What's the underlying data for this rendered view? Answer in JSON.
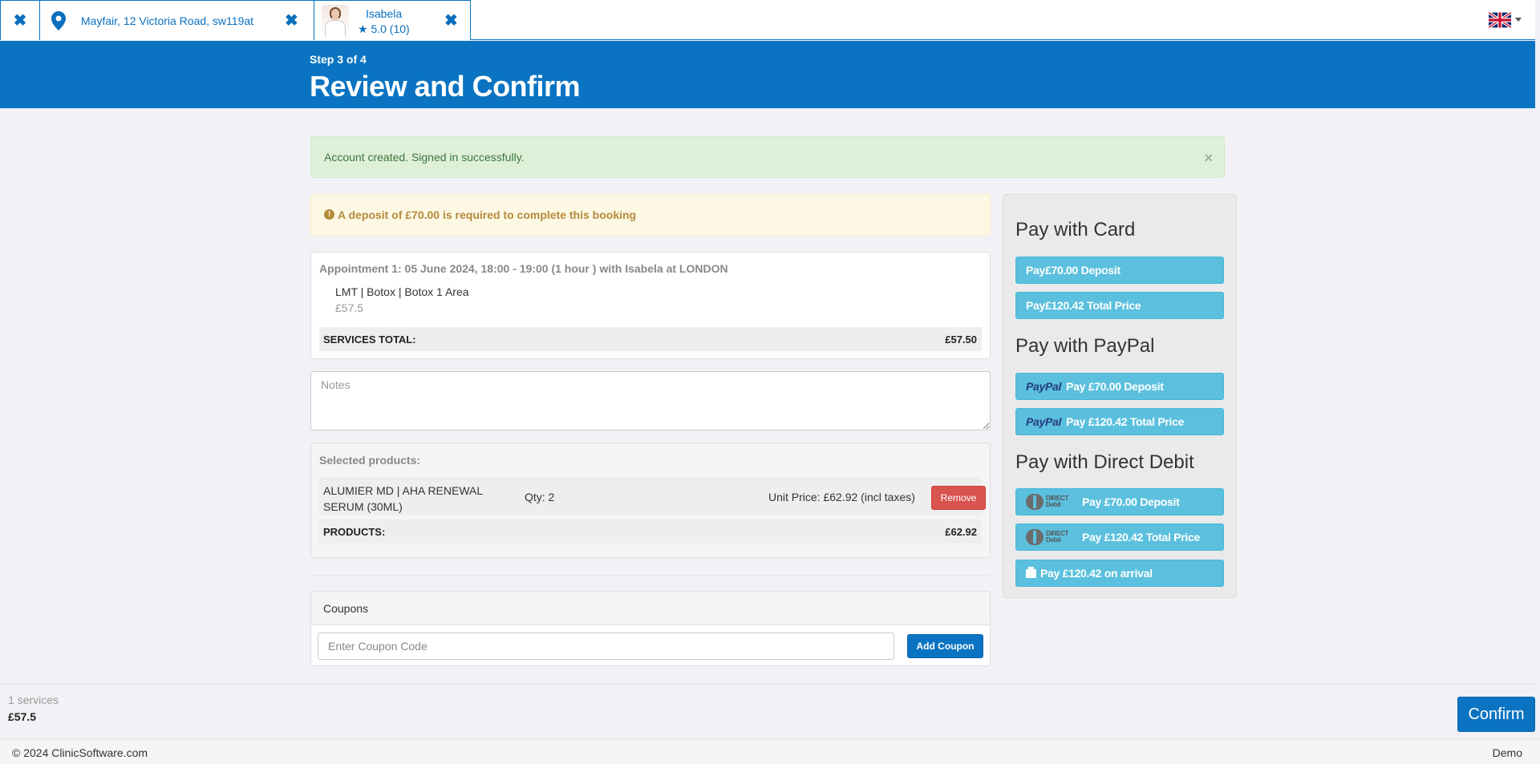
{
  "tabs": {
    "location_label": "Mayfair, 12 Victoria Road, sw119at",
    "staff_name": "Isabela",
    "staff_rating": "★ 5.0 (10)"
  },
  "header": {
    "step": "Step 3 of 4",
    "title": "Review and Confirm"
  },
  "alerts": {
    "success": "Account created. Signed in successfully.",
    "success_close": "×",
    "warning": "A deposit of £70.00 is required to complete this booking"
  },
  "appointment": {
    "title": "Appointment 1:  05 June 2024, 18:00 - 19:00 (1 hour ) with Isabela at LONDON",
    "service": "LMT | Botox | Botox 1 Area",
    "price": "£57.5",
    "total_label": "SERVICES TOTAL:",
    "total_value": "£57.50"
  },
  "notes": {
    "placeholder": "Notes"
  },
  "products": {
    "title": "Selected products:",
    "items": [
      {
        "name": "ALUMIER MD | AHA RENEWAL SERUM (30ML)",
        "qty": "Qty: 2",
        "unit_price": "Unit Price: £62.92 (incl taxes)",
        "remove_label": "Remove"
      }
    ],
    "total_label": "PRODUCTS:",
    "total_value": "£62.92"
  },
  "coupons": {
    "title": "Coupons",
    "placeholder": "Enter Coupon Code",
    "add_label": "Add Coupon"
  },
  "payment": {
    "card_heading": "Pay with Card",
    "card_deposit": "Pay£70.00 Deposit",
    "card_total": "Pay£120.42 Total Price",
    "paypal_heading": "Pay with PayPal",
    "paypal_logo": "PayPal",
    "paypal_deposit": "Pay £70.00 Deposit",
    "paypal_total": "Pay £120.42 Total Price",
    "dd_heading": "Pay with Direct Debit",
    "dd_logo_line1": "DIRECT",
    "dd_logo_line2": "Debit",
    "dd_deposit": "Pay £70.00 Deposit",
    "dd_total": "Pay £120.42 Total Price",
    "arrival": "Pay £120.42 on arrival"
  },
  "summary": {
    "count": "1 services",
    "sum": "£57.5",
    "confirm_label": "Confirm"
  },
  "footer": {
    "copyright": "© 2024 ClinicSoftware.com",
    "mode": "Demo"
  },
  "colors": {
    "brand_blue": "#0a74c2",
    "pay_button": "#5bc0de",
    "remove_button": "#d9534f",
    "success_bg": "#dff0d8",
    "warning_bg": "#fcf8e3"
  }
}
